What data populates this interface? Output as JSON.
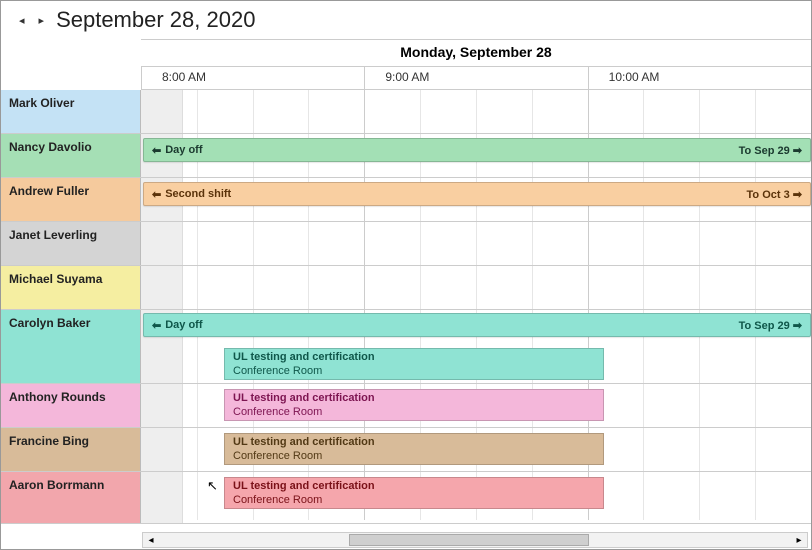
{
  "header": {
    "date_title": "September 28, 2020",
    "day_label": "Monday, September 28"
  },
  "time_ruler": [
    "8:00 AM",
    "9:00 AM",
    "10:00 AM"
  ],
  "resources": [
    {
      "name": "Mark Oliver"
    },
    {
      "name": "Nancy Davolio",
      "span": {
        "label": "Day off",
        "ends": "To Sep 29",
        "color": "green"
      }
    },
    {
      "name": "Andrew Fuller",
      "span": {
        "label": "Second shift",
        "ends": "To Oct 3",
        "color": "orange"
      }
    },
    {
      "name": "Janet Leverling"
    },
    {
      "name": "Michael Suyama"
    },
    {
      "name": "Carolyn Baker",
      "span": {
        "label": "Day off",
        "ends": "To Sep 29",
        "color": "teal"
      },
      "block": {
        "title": "UL testing and certification",
        "location": "Conference Room",
        "color": "teal"
      }
    },
    {
      "name": "Anthony Rounds",
      "block": {
        "title": "UL testing and certification",
        "location": "Conference Room",
        "color": "pink"
      }
    },
    {
      "name": "Francine Bing",
      "block": {
        "title": "UL testing and certification",
        "location": "Conference Room",
        "color": "tan"
      }
    },
    {
      "name": "Aaron Borrmann",
      "block": {
        "title": "UL testing and certification",
        "location": "Conference Room",
        "color": "red"
      }
    }
  ]
}
